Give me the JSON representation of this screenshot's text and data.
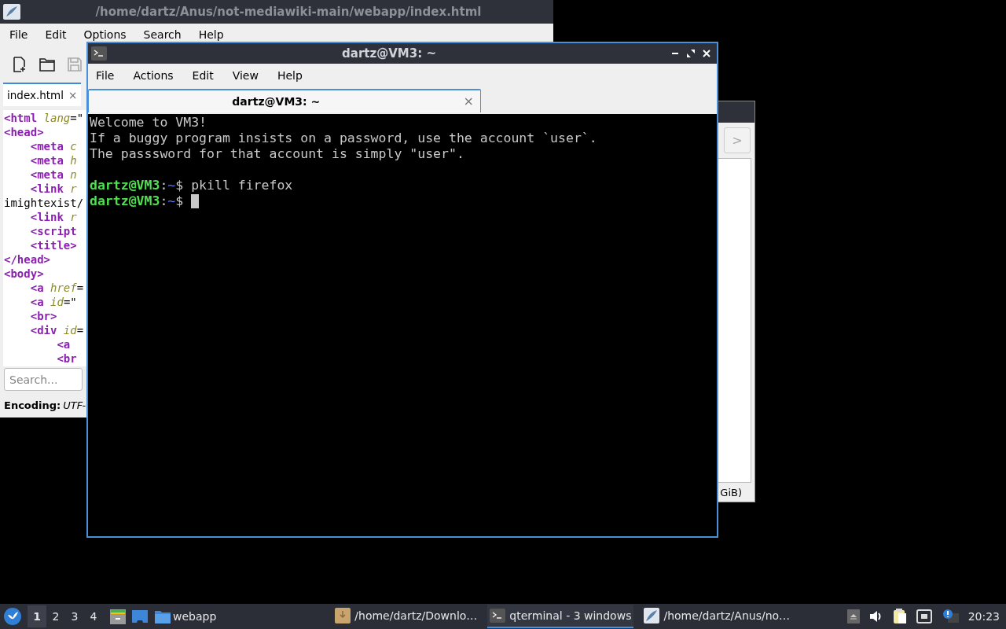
{
  "editor_window": {
    "title": "/home/dartz/Anus/not-mediawiki-main/webapp/index.html",
    "menu": [
      "File",
      "Edit",
      "Options",
      "Search",
      "Help"
    ],
    "tabs": [
      {
        "label": "index.html",
        "close": "×",
        "selected": true
      }
    ],
    "code_lines": [
      [
        {
          "kind": "tag",
          "text": "<html "
        },
        {
          "kind": "attr",
          "text": "lang"
        },
        {
          "kind": "plain",
          "text": "=\""
        }
      ],
      [
        {
          "kind": "tag",
          "text": "<head>"
        }
      ],
      [
        {
          "kind": "tag",
          "text": "    <meta "
        },
        {
          "kind": "attr",
          "text": "c"
        }
      ],
      [
        {
          "kind": "tag",
          "text": "    <meta "
        },
        {
          "kind": "attr",
          "text": "h"
        }
      ],
      [
        {
          "kind": "tag",
          "text": "    <meta "
        },
        {
          "kind": "attr",
          "text": "n"
        }
      ],
      [
        {
          "kind": "tag",
          "text": "    <link "
        },
        {
          "kind": "attr",
          "text": "r"
        }
      ],
      [
        {
          "kind": "plain",
          "text": "imightexist/"
        }
      ],
      [
        {
          "kind": "tag",
          "text": "    <link "
        },
        {
          "kind": "attr",
          "text": "r"
        }
      ],
      [
        {
          "kind": "tag",
          "text": "    <script"
        }
      ],
      [
        {
          "kind": "tag",
          "text": "    <title>"
        }
      ],
      [
        {
          "kind": "tag",
          "text": "</head>"
        }
      ],
      [
        {
          "kind": "tag",
          "text": "<body>"
        }
      ],
      [
        {
          "kind": "tag",
          "text": "    <a "
        },
        {
          "kind": "attr",
          "text": "href"
        },
        {
          "kind": "plain",
          "text": "="
        }
      ],
      [
        {
          "kind": "tag",
          "text": "    <a "
        },
        {
          "kind": "attr",
          "text": "id"
        },
        {
          "kind": "plain",
          "text": "=\""
        }
      ],
      [
        {
          "kind": "tag",
          "text": "    <br>"
        }
      ],
      [
        {
          "kind": "tag",
          "text": "    <div "
        },
        {
          "kind": "attr",
          "text": "id"
        },
        {
          "kind": "plain",
          "text": "="
        }
      ],
      [
        {
          "kind": "tag",
          "text": "        <a"
        }
      ],
      [
        {
          "kind": "tag",
          "text": "        <br"
        }
      ]
    ],
    "search": {
      "placeholder": "Search..."
    },
    "status": {
      "label": "Encoding:",
      "value": "UTF-"
    }
  },
  "back_window": {
    "button": ">",
    "status_fragment": "GiB)"
  },
  "terminal_window": {
    "title": "dartz@VM3: ~",
    "menu": [
      "File",
      "Actions",
      "Edit",
      "View",
      "Help"
    ],
    "tabs": [
      {
        "label": "dartz@VM3: ~",
        "close": "×",
        "selected": true
      }
    ],
    "lines": [
      {
        "kind": "output",
        "text": "Welcome to VM3!"
      },
      {
        "kind": "output",
        "text": "If a buggy program insists on a password, use the account `user`."
      },
      {
        "kind": "output",
        "text": "The passsword for that account is simply \"user\"."
      },
      {
        "kind": "blank"
      },
      {
        "kind": "prompt",
        "user": "dartz@VM3",
        "sep": ":",
        "path": "~",
        "symbol": "$",
        "command": "pkill firefox"
      },
      {
        "kind": "prompt",
        "user": "dartz@VM3",
        "sep": ":",
        "path": "~",
        "symbol": "$",
        "cursor": true
      }
    ]
  },
  "taskbar": {
    "workspaces": [
      {
        "label": "1",
        "selected": true
      },
      {
        "label": "2",
        "selected": false
      },
      {
        "label": "3",
        "selected": false
      },
      {
        "label": "4",
        "selected": false
      }
    ],
    "launcher": {
      "label": "webapp"
    },
    "tasks": [
      {
        "label": "/home/dartz/Downlo…",
        "selected": false
      },
      {
        "label": "qterminal - 3 windows",
        "selected": true
      },
      {
        "label": "/home/dartz/Anus/no…",
        "selected": false
      }
    ],
    "clock": "20:23"
  }
}
